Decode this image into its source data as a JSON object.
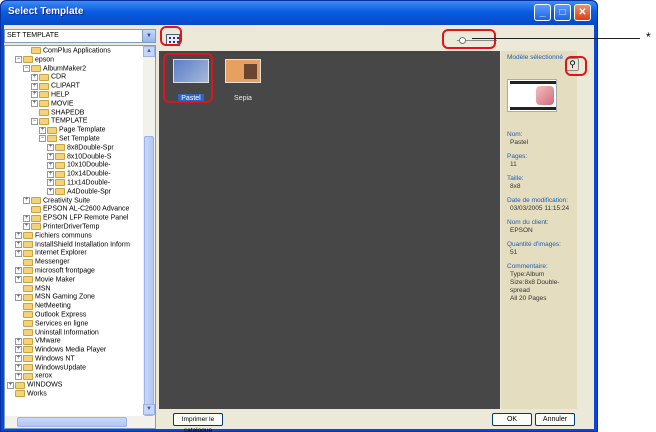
{
  "window": {
    "title": "Select Template",
    "controls": [
      "minimize",
      "maximize",
      "close"
    ]
  },
  "folder_select": {
    "value": "SET TEMPLATE"
  },
  "tree": [
    {
      "label": "ComPlus Applications",
      "depth": 2,
      "expand": "none"
    },
    {
      "label": "epson",
      "depth": 1,
      "expand": "minus"
    },
    {
      "label": "AlbumMaker2",
      "depth": 2,
      "expand": "minus"
    },
    {
      "label": "CDR",
      "depth": 3,
      "expand": "plus"
    },
    {
      "label": "CLIPART",
      "depth": 3,
      "expand": "plus"
    },
    {
      "label": "HELP",
      "depth": 3,
      "expand": "plus"
    },
    {
      "label": "MOVIE",
      "depth": 3,
      "expand": "plus"
    },
    {
      "label": "SHAPEDB",
      "depth": 3,
      "expand": "none"
    },
    {
      "label": "TEMPLATE",
      "depth": 3,
      "expand": "minus"
    },
    {
      "label": "Page Template",
      "depth": 4,
      "expand": "plus"
    },
    {
      "label": "Set Template",
      "depth": 4,
      "expand": "minus"
    },
    {
      "label": "8x8Double-Spr",
      "depth": 5,
      "expand": "plus"
    },
    {
      "label": "8x10Double-S",
      "depth": 5,
      "expand": "plus"
    },
    {
      "label": "10x10Double-",
      "depth": 5,
      "expand": "plus"
    },
    {
      "label": "10x14Double-",
      "depth": 5,
      "expand": "plus"
    },
    {
      "label": "11x14Double-",
      "depth": 5,
      "expand": "plus"
    },
    {
      "label": "A4Double-Spr",
      "depth": 5,
      "expand": "plus"
    },
    {
      "label": "Creativity Suite",
      "depth": 2,
      "expand": "plus"
    },
    {
      "label": "EPSON AL-C2600 Advance",
      "depth": 2,
      "expand": "none"
    },
    {
      "label": "EPSON LFP Remote Panel",
      "depth": 2,
      "expand": "plus"
    },
    {
      "label": "PrinterDriverTemp",
      "depth": 2,
      "expand": "plus"
    },
    {
      "label": "Fichiers communs",
      "depth": 1,
      "expand": "plus"
    },
    {
      "label": "InstallShield Installation Inform",
      "depth": 1,
      "expand": "plus"
    },
    {
      "label": "Internet Explorer",
      "depth": 1,
      "expand": "plus"
    },
    {
      "label": "Messenger",
      "depth": 1,
      "expand": "none"
    },
    {
      "label": "microsoft frontpage",
      "depth": 1,
      "expand": "plus"
    },
    {
      "label": "Movie Maker",
      "depth": 1,
      "expand": "plus"
    },
    {
      "label": "MSN",
      "depth": 1,
      "expand": "none"
    },
    {
      "label": "MSN Gaming Zone",
      "depth": 1,
      "expand": "plus"
    },
    {
      "label": "NetMeeting",
      "depth": 1,
      "expand": "none"
    },
    {
      "label": "Outlook Express",
      "depth": 1,
      "expand": "none"
    },
    {
      "label": "Services en ligne",
      "depth": 1,
      "expand": "none"
    },
    {
      "label": "Uninstall Information",
      "depth": 1,
      "expand": "none"
    },
    {
      "label": "VMware",
      "depth": 1,
      "expand": "plus"
    },
    {
      "label": "Windows Media Player",
      "depth": 1,
      "expand": "plus"
    },
    {
      "label": "Windows NT",
      "depth": 1,
      "expand": "plus"
    },
    {
      "label": "WindowsUpdate",
      "depth": 1,
      "expand": "plus"
    },
    {
      "label": "xerox",
      "depth": 1,
      "expand": "plus"
    },
    {
      "label": "WINDOWS",
      "depth": 0,
      "expand": "plus"
    },
    {
      "label": "Works",
      "depth": 0,
      "expand": "none"
    }
  ],
  "templates": [
    {
      "name": "Pastel",
      "selected": true
    },
    {
      "name": "Sepia",
      "selected": false
    }
  ],
  "info_panel": {
    "selected_title": "Modèle sélectionné",
    "fields": [
      {
        "key": "Nom:",
        "value": "Pastel"
      },
      {
        "key": "Pages:",
        "value": "11"
      },
      {
        "key": "Taille:",
        "value": "8x8"
      },
      {
        "key": "Date de modification:",
        "value": "03/03/2005 11:15:24"
      },
      {
        "key": "Nom du client:",
        "value": "EPSON"
      },
      {
        "key": "Quantité d'images:",
        "value": "51"
      },
      {
        "key": "Commentaire:",
        "value": "Type:Album\nSize:8x8 Double-spread\nAll 20 Pages"
      }
    ]
  },
  "buttons": {
    "catalog": "Imprimer le catalogue",
    "ok": "OK",
    "cancel": "Annuler"
  },
  "annotation": {
    "marker": "*"
  },
  "colors": {
    "title_bar": "#0a5ce0",
    "client": "#ece9d8",
    "gallery_bg": "#474747",
    "info_bg": "#e4ddbf",
    "link_text": "#1e5fb4",
    "callout": "#e0151b"
  }
}
